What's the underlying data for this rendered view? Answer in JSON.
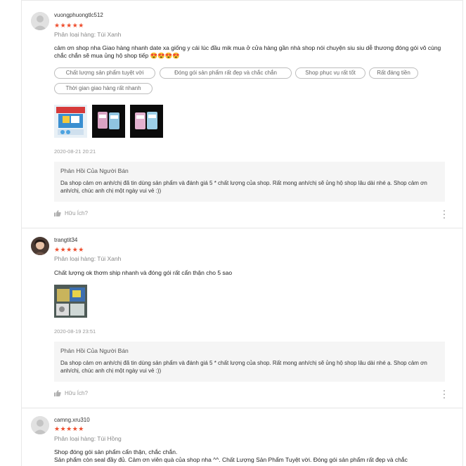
{
  "reviews": [
    {
      "username": "vuongphuongtlc512",
      "stars": "★★★★★",
      "variation": "Phân loại hàng: Túi Xanh",
      "comment": "cảm ơn shop nha Giao hàng nhanh  date xa giống y cái lúc đầu mik mua ở cửa hàng gần nhà  shop nói chuyện siu siu dễ thương đóng gói vô cùng chắc chắn sẽ mua ủng hộ shop tiếp 😍😍😍😍",
      "tags": [
        "Chất lượng sản phẩm tuyệt vời",
        "Đóng gói sản phẩm rất đẹp và chắc chắn",
        "Shop phục vụ rất tốt",
        "Rất đáng tiền",
        "Thời gian giao hàng rất nhanh"
      ],
      "timestamp": "2020-08-21 20:21",
      "seller_title": "Phản Hồi Của Người Bán",
      "seller_reply": "Da shop cảm ơn anh/chị đã tin dùng sản phẩm và đánh giá 5 * chất lượng của shop. Rất mong anh/chị sẽ ủng hộ shop lâu dài nhé ạ. Shop cảm ơn anh/chị, chúc anh chị một ngày vui vẻ :))",
      "helpful": "Hữu Ích?"
    },
    {
      "username": "trangtit34",
      "stars": "★★★★★",
      "variation": "Phân loại hàng: Túi Xanh",
      "comment": "Chất lượng ok thơm ship nhanh và đóng gói rất cẩn thận cho 5 sao",
      "tags": [],
      "timestamp": "2020-08-19 23:51",
      "seller_title": "Phản Hồi Của Người Bán",
      "seller_reply": "Da shop cảm ơn anh/chị đã tin dùng sản phẩm và đánh giá 5 * chất lượng của shop. Rất mong anh/chị sẽ ủng hộ shop lâu dài nhé ạ. Shop cảm ơn anh/chị, chúc anh chị một ngày vui vẻ :))",
      "helpful": "Hữu Ích?"
    },
    {
      "username": "camng.xru310",
      "stars": "★★★★★",
      "variation": "Phân loại hàng: Túi Hồng",
      "comment": "Shop đóng gói sản phẩm cẩn thận, chắc chắn.\nSản phẩm còn seal đầy đủ. Cảm ơn viên quà của shop nha ^^. Chất Lượng Sản Phẩm Tuyệt vời. Đóng gói sản phẩm rất đẹp và chắc",
      "tags": [],
      "timestamp": "",
      "seller_title": "",
      "seller_reply": "",
      "helpful": ""
    }
  ],
  "icons": {
    "thumb": "thumb-up-icon",
    "more": "more-vertical-icon",
    "avatar": "avatar-icon"
  },
  "colors": {
    "star": "#ee4d2d",
    "seller_box": "#f5f5f5"
  }
}
